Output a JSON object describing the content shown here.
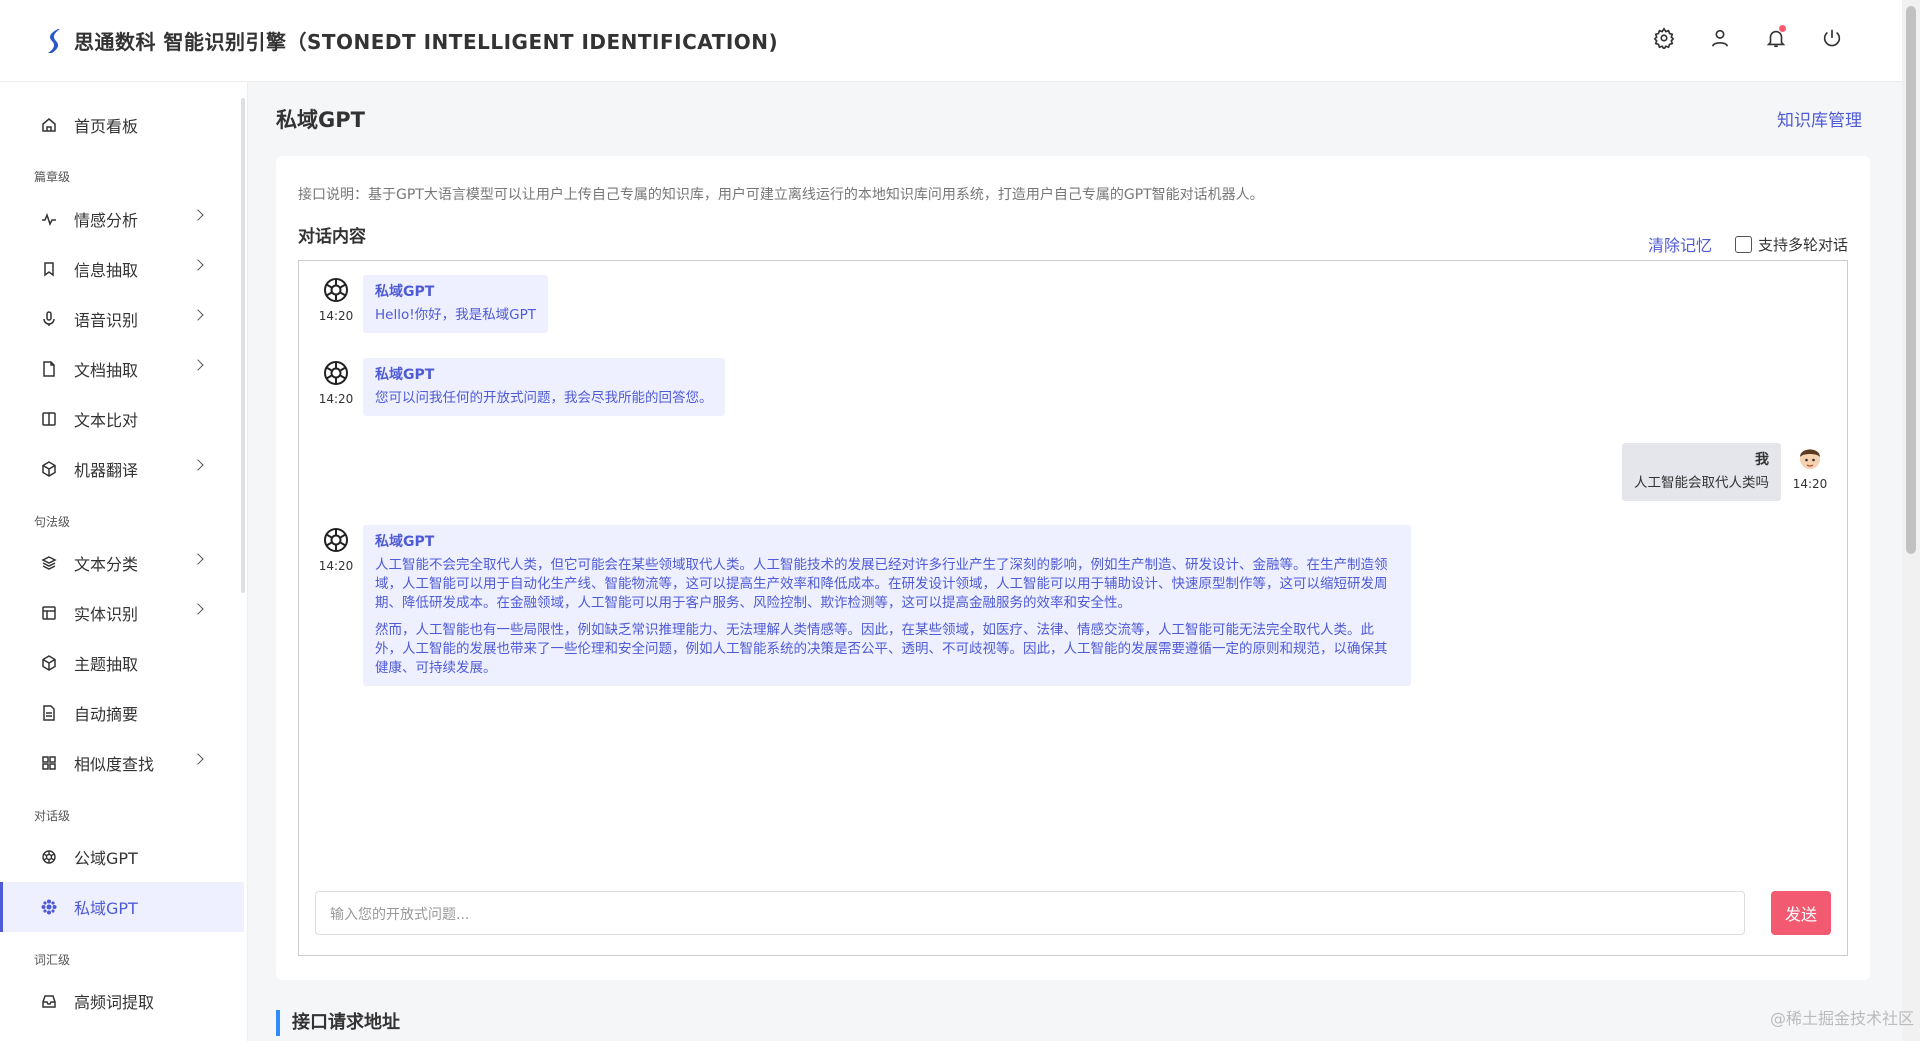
{
  "header": {
    "title": "思通数科 智能识别引擎（STONEDT INTELLIGENT IDENTIFICATION)",
    "icons": [
      "gear-icon",
      "user-icon",
      "bell-icon",
      "power-icon"
    ]
  },
  "sidebar": {
    "items": [
      {
        "label": "首页看板",
        "icon": "home-icon"
      },
      {
        "label": "篇章级",
        "group": true
      },
      {
        "label": "情感分析",
        "icon": "pulse-icon",
        "chevron": true
      },
      {
        "label": "信息抽取",
        "icon": "bookmark-icon",
        "chevron": true
      },
      {
        "label": "语音识别",
        "icon": "mic-icon",
        "chevron": true
      },
      {
        "label": "文档抽取",
        "icon": "file-icon",
        "chevron": true
      },
      {
        "label": "文本比对",
        "icon": "columns-icon"
      },
      {
        "label": "机器翻译",
        "icon": "cube-icon",
        "chevron": true
      },
      {
        "label": "句法级",
        "group": true
      },
      {
        "label": "文本分类",
        "icon": "layers-icon",
        "chevron": true
      },
      {
        "label": "实体识别",
        "icon": "layout-icon",
        "chevron": true
      },
      {
        "label": "主题抽取",
        "icon": "box-icon"
      },
      {
        "label": "自动摘要",
        "icon": "doc-icon"
      },
      {
        "label": "相似度查找",
        "icon": "grid-icon",
        "chevron": true
      },
      {
        "label": "对话级",
        "group": true
      },
      {
        "label": "公域GPT",
        "icon": "openai-icon"
      },
      {
        "label": "私域GPT",
        "icon": "sparkle-icon",
        "active": true
      },
      {
        "label": "词汇级",
        "group": true
      },
      {
        "label": "高频词提取",
        "icon": "inbox-icon"
      }
    ]
  },
  "main": {
    "page_title": "私域GPT",
    "kb_link": "知识库管理",
    "description": "接口说明：基于GPT大语言模型可以让用户上传自己专属的知识库，用户可建立离线运行的本地知识库问用系统，打造用户自己专属的GPT智能对话机器人。",
    "conversation_label": "对话内容",
    "clear_memory": "清除记忆",
    "multi_turn_label": "支持多轮对话",
    "messages": [
      {
        "sender": "私域GPT",
        "time": "14:20",
        "text": "Hello!你好，我是私域GPT"
      },
      {
        "sender": "私域GPT",
        "time": "14:20",
        "text": "您可以问我任何的开放式问题，我会尽我所能的回答您。"
      },
      {
        "sender": "我",
        "time": "14:20",
        "text": "人工智能会取代人类吗"
      },
      {
        "sender": "私域GPT",
        "time": "14:20",
        "p1": "人工智能不会完全取代人类，但它可能会在某些领域取代人类。人工智能技术的发展已经对许多行业产生了深刻的影响，例如生产制造、研发设计、金融等。在生产制造领域，人工智能可以用于自动化生产线、智能物流等，这可以提高生产效率和降低成本。在研发设计领域，人工智能可以用于辅助设计、快速原型制作等，这可以缩短研发周期、降低研发成本。在金融领域，人工智能可以用于客户服务、风险控制、欺诈检测等，这可以提高金融服务的效率和安全性。",
        "p2": "然而，人工智能也有一些局限性，例如缺乏常识推理能力、无法理解人类情感等。因此，在某些领域，如医疗、法律、情感交流等，人工智能可能无法完全取代人类。此外，人工智能的发展也带来了一些伦理和安全问题，例如人工智能系统的决策是否公平、透明、不可歧视等。因此，人工智能的发展需要遵循一定的原则和规范，以确保其健康、可持续发展。"
      }
    ],
    "input_placeholder": "输入您的开放式问题...",
    "send_label": "发送",
    "api_section_title": "接口请求地址"
  },
  "watermark": "@稀土掘金技术社区"
}
